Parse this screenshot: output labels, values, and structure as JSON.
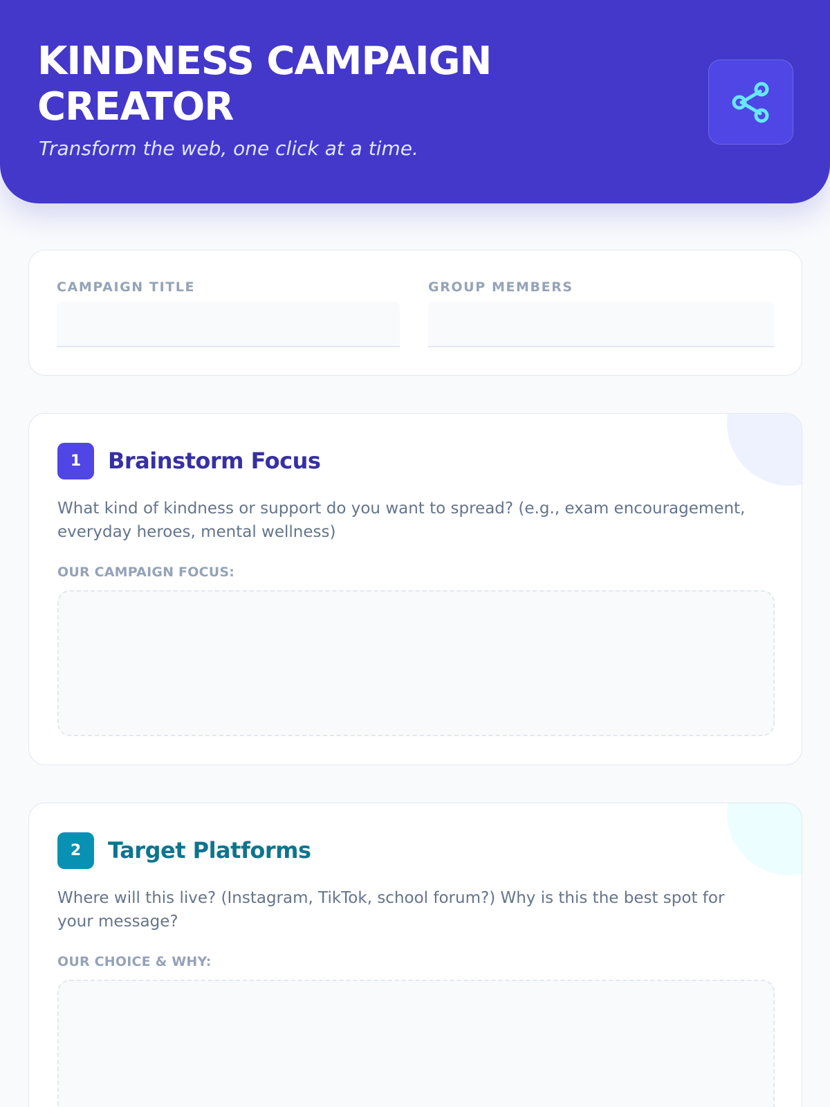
{
  "header": {
    "title": "KINDNESS CAMPAIGN CREATOR",
    "subtitle": "Transform the web, one click at a time.",
    "share_icon": "share-icon"
  },
  "meta": {
    "campaign_title_label": "CAMPAIGN TITLE",
    "campaign_title_value": "",
    "group_members_label": "GROUP MEMBERS",
    "group_members_value": ""
  },
  "steps": [
    {
      "number": "1",
      "title": "Brainstorm Focus",
      "prompt": "What kind of kindness or support do you want to spread? (e.g., exam encouragement, everyday heroes, mental wellness)",
      "answer_label": "OUR CAMPAIGN FOCUS:",
      "answer_value": ""
    },
    {
      "number": "2",
      "title": "Target Platforms",
      "prompt": "Where will this live? (Instagram, TikTok, school forum?) Why is this the best spot for your message?",
      "answer_label": "OUR CHOICE & WHY:",
      "answer_value": ""
    }
  ],
  "colors": {
    "header_bg": "#4338ca",
    "step1_accent": "#4f46e5",
    "step1_title": "#3730a3",
    "step1_deco": "#eef2ff",
    "step2_accent": "#0891b2",
    "step2_title": "#0e7490",
    "step2_deco": "#ecfeff",
    "share_icon": "#67e8f9"
  }
}
